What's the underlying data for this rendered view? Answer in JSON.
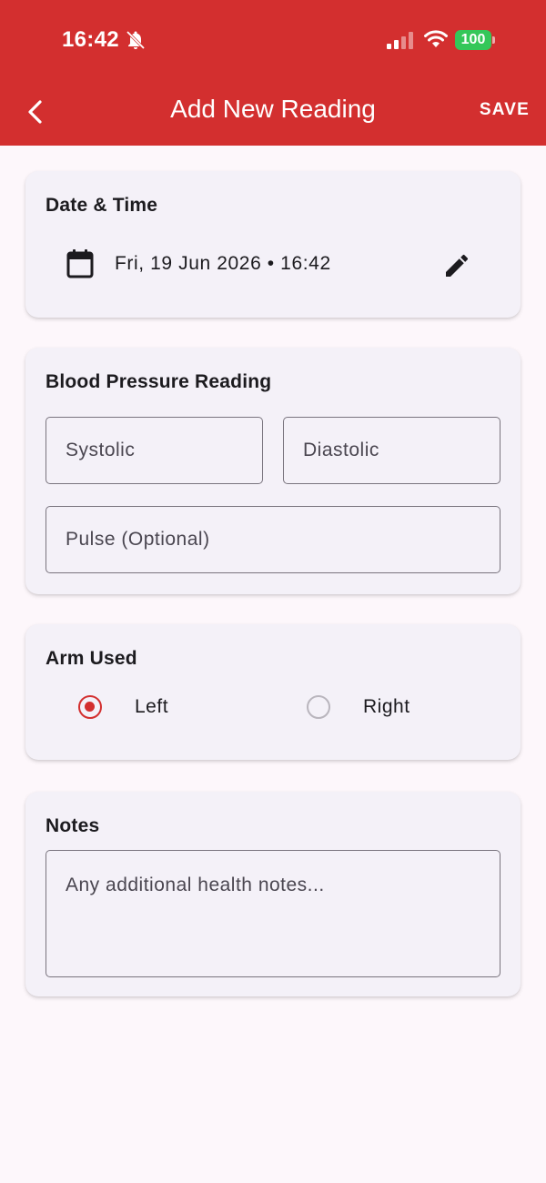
{
  "status_bar": {
    "time": "16:42",
    "battery": "100",
    "icons": [
      "bell-slash-icon",
      "signal-icon",
      "wifi-icon",
      "battery-icon"
    ]
  },
  "app_bar": {
    "title": "Add New Reading",
    "back_icon": "chevron-left-icon",
    "save_label": "SAVE"
  },
  "date_card": {
    "title": "Date & Time",
    "value": "Fri, 19 Jun 2026 • 16:42",
    "icons": [
      "calendar-icon",
      "pencil-icon"
    ]
  },
  "bp_card": {
    "title": "Blood Pressure Reading",
    "systolic_placeholder": "Systolic",
    "diastolic_placeholder": "Diastolic",
    "pulse_placeholder": "Pulse (Optional)",
    "systolic_value": "",
    "diastolic_value": "",
    "pulse_value": ""
  },
  "arm_card": {
    "title": "Arm Used",
    "options": [
      {
        "label": "Left",
        "selected": true
      },
      {
        "label": "Right",
        "selected": false
      }
    ]
  },
  "notes_card": {
    "title": "Notes",
    "placeholder": "Any additional health notes...",
    "value": ""
  },
  "colors": {
    "primary": "#d32f2f",
    "background": "#fdf7fb",
    "card": "#f4f1f8",
    "battery": "#34c759"
  }
}
